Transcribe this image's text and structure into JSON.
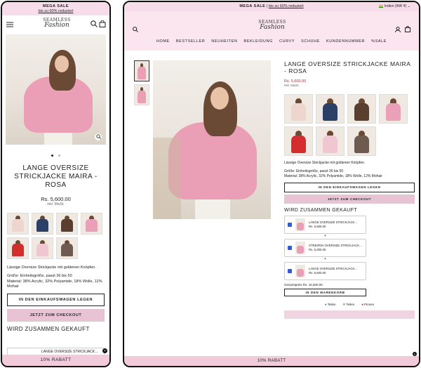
{
  "announcement": {
    "title": "MEGA SALE",
    "subtitle": "bis zu 60% reduziert"
  },
  "logo": {
    "line1": "SEAMLESS",
    "line2": "Fashion"
  },
  "currency": "Indien (INR ₹)",
  "nav": [
    "HOME",
    "BESTSELLER",
    "NEUHEITEN",
    "BEKLEIDUNG",
    "CURVY",
    "SCHUHE",
    "KUNDENNUMMER",
    "%SALE"
  ],
  "product": {
    "title_mobile": "LANGE OVERSIZE STRICKJACKE MAIRA - ROSA",
    "title_desktop": "LANGE OVERSIZE STRICKJACKE MAIRA - ROSA",
    "price": "Rs. 5,600.00",
    "tax": "inkl. MwSt.",
    "description": "Lässige Oversize Strickjacke mit goldenen Knöpfen.",
    "size": "Größe: Einheitsgröße, passt 36 bis 50",
    "material": "Material: 38% Acrylic, 32% Polyamide, 18% Wolle, 12% Mohair"
  },
  "buttons": {
    "add_to_cart": "IN DEN EINKAUFSWAGEN LEGEN",
    "checkout": "JETZT ZUM CHECKOUT",
    "add_bundle": "IN DEN WARENKORB"
  },
  "bundle": {
    "heading": "WIRD ZUSAMMEN GEKAUFT",
    "items": [
      {
        "name": "LANGE OVERSIZE STRICKJACK...",
        "price": "Rs. 5,600.00"
      },
      {
        "name": "STREIFEN OVERSIZE STRICKJACK...",
        "price": "Rs. 5,300.00"
      },
      {
        "name": "LANGE OVERSIZE STRICKJACK...",
        "price": "Rs. 5,600.00"
      }
    ],
    "plus": "+",
    "total_label": "Gesamtpreis",
    "total": "Rs. 16,500.00"
  },
  "share": {
    "facebook": "Teilen",
    "x": "Teilen",
    "pinterest": "Pinnen"
  },
  "discount_bar": "10% RABATT",
  "colors": {
    "pink": "#e8c3d3",
    "announce": "#f7dde9",
    "checkbox": "#2f5bd6"
  },
  "swatches": [
    "#eed6cf",
    "#2c3f66",
    "#5a3e2e",
    "#e9a0b8",
    "#d42d2d",
    "#f0c6d1",
    "#6e5a4f"
  ]
}
